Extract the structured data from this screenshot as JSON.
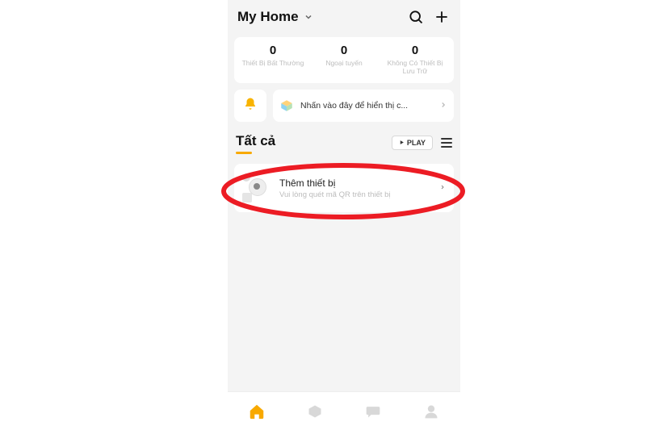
{
  "header": {
    "title": "My Home"
  },
  "stats": [
    {
      "value": "0",
      "label": "Thiết Bị Bất Thường"
    },
    {
      "value": "0",
      "label": "Ngoại tuyến"
    },
    {
      "value": "0",
      "label": "Không Có Thiết Bị Lưu Trữ"
    }
  ],
  "notice": {
    "text": "Nhấn vào đây để hiển thị c..."
  },
  "section": {
    "title": "Tất cả",
    "play_label": "PLAY"
  },
  "device": {
    "title": "Thêm thiết bị",
    "subtitle": "Vui lòng quét mã QR trên thiết bị"
  }
}
